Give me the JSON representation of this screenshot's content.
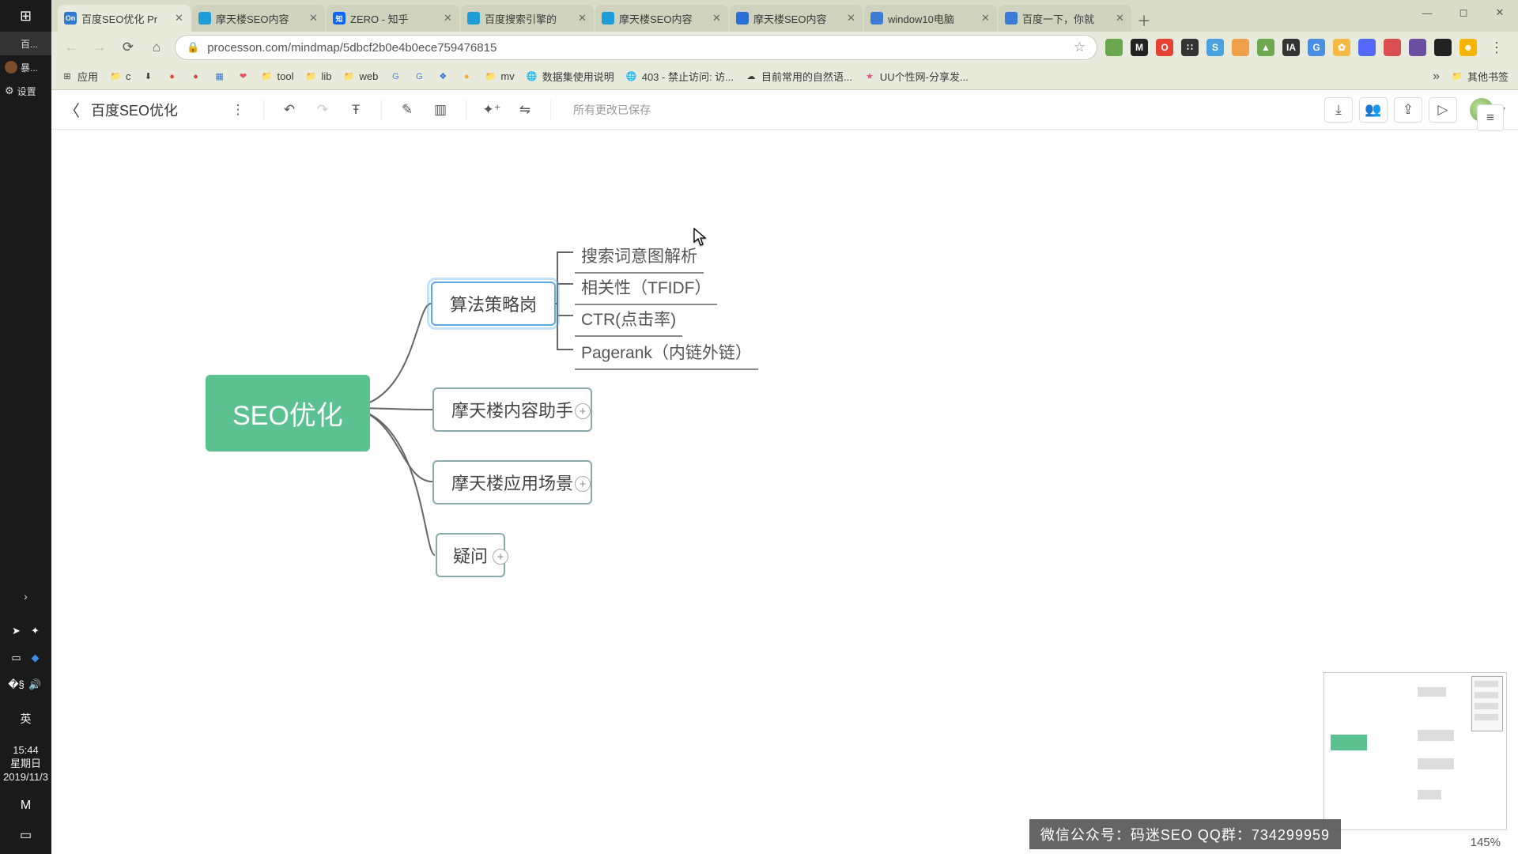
{
  "taskbar": {
    "apps": [
      {
        "label": "百...",
        "icon_bg": "#4285f4",
        "icon_txt": "C"
      },
      {
        "label": "暴...",
        "icon_bg": "#7a4d2b",
        "icon_txt": ""
      }
    ],
    "settings": "设置",
    "lang": "英",
    "clock": {
      "time": "15:44",
      "weekday": "星期日",
      "date": "2019/11/3"
    }
  },
  "browser": {
    "tabs": [
      {
        "title": "百度SEO优化 Pr",
        "fav_bg": "#2f7ad1",
        "fav_txt": "On",
        "active": true
      },
      {
        "title": "摩天楼SEO内容",
        "fav_bg": "#1e9cd8",
        "fav_txt": ""
      },
      {
        "title": "ZERO - 知乎",
        "fav_bg": "#0a66ff",
        "fav_txt": "知"
      },
      {
        "title": "百度搜索引擎的",
        "fav_bg": "#1e9cd8",
        "fav_txt": ""
      },
      {
        "title": "摩天楼SEO内容",
        "fav_bg": "#1e9cd8",
        "fav_txt": ""
      },
      {
        "title": "摩天楼SEO内容",
        "fav_bg": "#2a6fd6",
        "fav_txt": ""
      },
      {
        "title": "window10电脑",
        "fav_bg": "#3a7bd5",
        "fav_txt": ""
      },
      {
        "title": "百度一下，你就",
        "fav_bg": "#3a7bd5",
        "fav_txt": ""
      }
    ],
    "url": "processon.com/mindmap/5dbcf2b0e4b0ece759476815",
    "extensions": [
      {
        "bg": "#6aa84f",
        "t": ""
      },
      {
        "bg": "#222",
        "t": "M"
      },
      {
        "bg": "#e34234",
        "t": "O"
      },
      {
        "bg": "#333",
        "t": "∷"
      },
      {
        "bg": "#4aa3df",
        "t": "S"
      },
      {
        "bg": "#f0a04b",
        "t": ""
      },
      {
        "bg": "#6ea84f",
        "t": "▲"
      },
      {
        "bg": "#333",
        "t": "IA"
      },
      {
        "bg": "#4a90e2",
        "t": "G"
      },
      {
        "bg": "#f4b942",
        "t": "✿"
      },
      {
        "bg": "#5468ff",
        "t": ""
      },
      {
        "bg": "#d94f4f",
        "t": ""
      },
      {
        "bg": "#6b4fa1",
        "t": ""
      },
      {
        "bg": "#222",
        "t": ""
      },
      {
        "bg": "#f7b500",
        "t": "☻"
      }
    ],
    "bookmarks": [
      {
        "label": "应用",
        "icon": "⊞",
        "cls": ""
      },
      {
        "label": "c",
        "icon": "📁",
        "cls": "bm-folder"
      },
      {
        "label": "",
        "icon": "⬇",
        "cls": ""
      },
      {
        "label": "",
        "icon": "●",
        "cls": "",
        "color": "#e34234"
      },
      {
        "label": "",
        "icon": "●",
        "cls": "",
        "color": "#d1453b"
      },
      {
        "label": "",
        "icon": "▦",
        "cls": "",
        "color": "#2f7ad1"
      },
      {
        "label": "",
        "icon": "❤",
        "cls": "",
        "color": "#e0535f"
      },
      {
        "label": "tool",
        "icon": "📁",
        "cls": "bm-folder"
      },
      {
        "label": "lib",
        "icon": "📁",
        "cls": "bm-folder"
      },
      {
        "label": "web",
        "icon": "📁",
        "cls": "bm-folder"
      },
      {
        "label": "",
        "icon": "G",
        "cls": "",
        "color": "#4285f4"
      },
      {
        "label": "",
        "icon": "G",
        "cls": "",
        "color": "#4285f4"
      },
      {
        "label": "",
        "icon": "❖",
        "cls": "",
        "color": "#2a6fd6"
      },
      {
        "label": "",
        "icon": "●",
        "cls": "",
        "color": "#f4a742"
      },
      {
        "label": "mv",
        "icon": "📁",
        "cls": "bm-folder"
      },
      {
        "label": "数据集使用说明",
        "icon": "🌐",
        "cls": ""
      },
      {
        "label": "403 - 禁止访问: 访...",
        "icon": "🌐",
        "cls": ""
      },
      {
        "label": "目前常用的自然语...",
        "icon": "☁",
        "cls": ""
      },
      {
        "label": "UU个性网-分享发...",
        "icon": "★",
        "cls": "",
        "color": "#e94f8a"
      }
    ],
    "bookmarks_more": "»",
    "bookmarks_other": "其他书签"
  },
  "app": {
    "doc_title": "百度SEO优化",
    "save_status": "所有更改已保存",
    "zoom": "145%"
  },
  "mindmap": {
    "root": "SEO优化",
    "n_algorithm": "算法策略岗",
    "leaves_algorithm": [
      "搜索词意图解析",
      "相关性（TFIDF）",
      "CTR(点击率)",
      "Pagerank（内链外链）"
    ],
    "n_content": "摩天楼内容助手",
    "n_scene": "摩天楼应用场景",
    "n_question": "疑问"
  },
  "watermark": "微信公众号：码迷SEO QQ群：734299959"
}
